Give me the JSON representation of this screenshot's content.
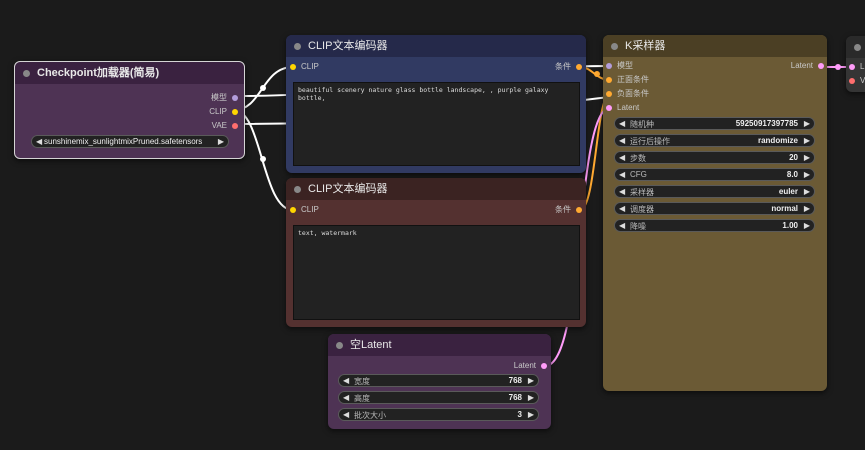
{
  "nodes": {
    "checkpoint": {
      "title": "Checkpoint加载器(简易)",
      "outputs": [
        "模型",
        "CLIP",
        "VAE"
      ],
      "ckpt_name": "sunshinemix_sunlightmixPruned.safetensors"
    },
    "clip_pos": {
      "title": "CLIP文本编码器",
      "input": "CLIP",
      "output": "条件",
      "text": "beautiful scenery nature glass bottle landscape, , purple galaxy bottle,"
    },
    "clip_neg": {
      "title": "CLIP文本编码器",
      "input": "CLIP",
      "output": "条件",
      "text": "text, watermark"
    },
    "ksampler": {
      "title": "K采样器",
      "inputs": [
        "模型",
        "正面条件",
        "负面条件",
        "Latent"
      ],
      "output": "Latent",
      "widgets": [
        {
          "label": "随机种",
          "value": "59250917397785"
        },
        {
          "label": "运行后操作",
          "value": "randomize"
        },
        {
          "label": "步数",
          "value": "20"
        },
        {
          "label": "CFG",
          "value": "8.0"
        },
        {
          "label": "采样器",
          "value": "euler"
        },
        {
          "label": "调度器",
          "value": "normal"
        },
        {
          "label": "降噪",
          "value": "1.00"
        }
      ]
    },
    "empty_latent": {
      "title": "空Latent",
      "output": "Latent",
      "widgets": [
        {
          "label": "宽度",
          "value": "768"
        },
        {
          "label": "高度",
          "value": "768"
        },
        {
          "label": "批次大小",
          "value": "3"
        }
      ]
    },
    "vae_decode": {
      "inputs": [
        "L",
        "V"
      ]
    }
  },
  "colors": {
    "canvas": "#1b1b1b",
    "model_pin": "#b39ddb",
    "clip_pin": "#ffd500",
    "vae_pin": "#ff6e6e",
    "cond_pin": "#ffa931",
    "latent_pin": "#ff9cf9"
  },
  "arrows": {
    "left": "◀",
    "right": "▶"
  }
}
